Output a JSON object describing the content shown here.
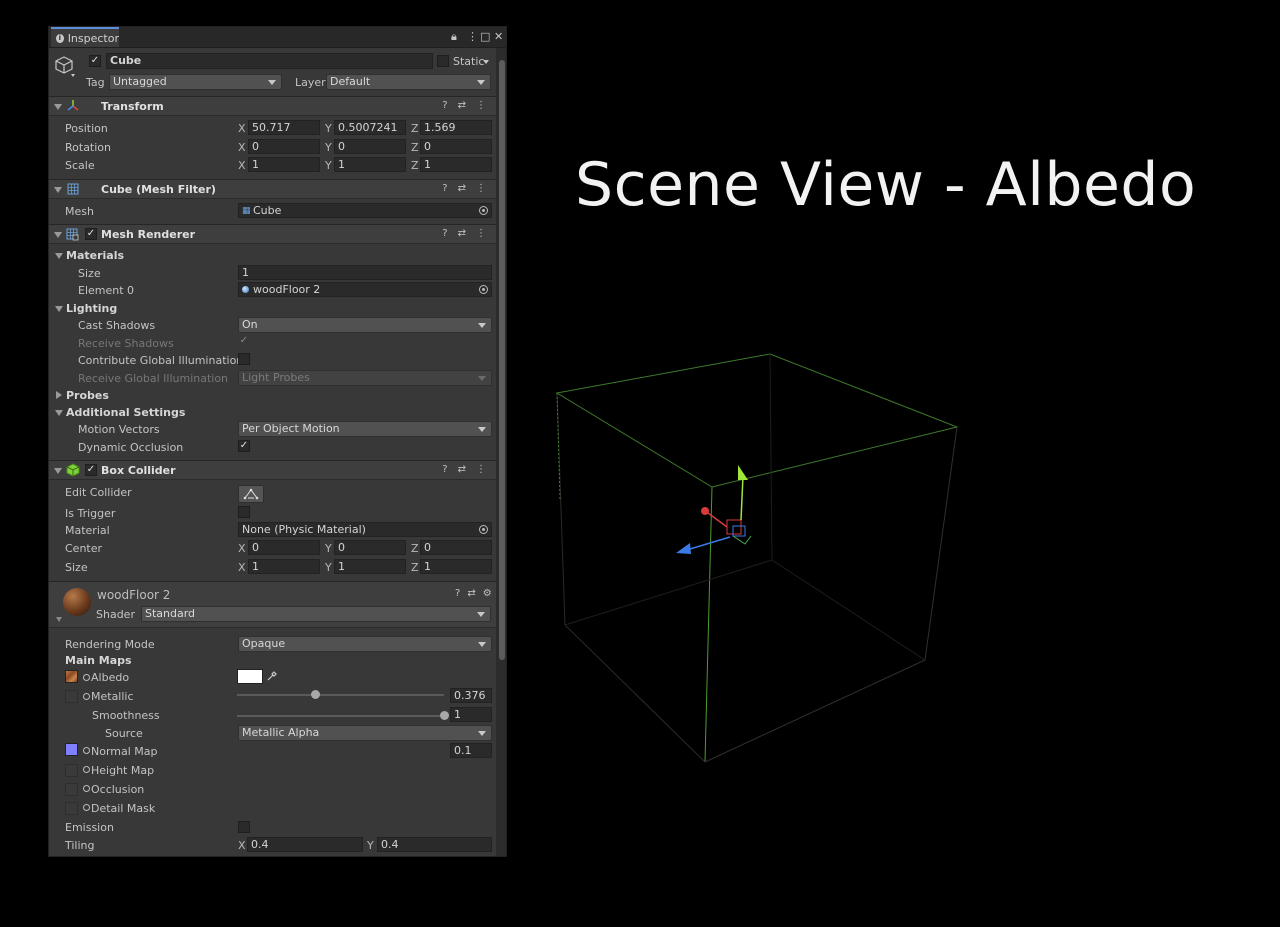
{
  "window": {
    "tab": "Inspector"
  },
  "object": {
    "name": "Cube",
    "static_label": "Static",
    "tag_label": "Tag",
    "tag_value": "Untagged",
    "layer_label": "Layer",
    "layer_value": "Default"
  },
  "transform": {
    "title": "Transform",
    "position_label": "Position",
    "position": {
      "x": "50.717",
      "y": "0.5007241",
      "z": "1.569"
    },
    "rotation_label": "Rotation",
    "rotation": {
      "x": "0",
      "y": "0",
      "z": "0"
    },
    "scale_label": "Scale",
    "scale": {
      "x": "1",
      "y": "1",
      "z": "1"
    }
  },
  "axes": {
    "x": "X",
    "y": "Y",
    "z": "Z"
  },
  "mesh_filter": {
    "title": "Cube (Mesh Filter)",
    "mesh_label": "Mesh",
    "mesh_value": "Cube"
  },
  "mesh_renderer": {
    "title": "Mesh Renderer",
    "materials_label": "Materials",
    "size_label": "Size",
    "size_value": "1",
    "element0_label": "Element 0",
    "element0_value": "woodFloor 2",
    "lighting_label": "Lighting",
    "cast_shadows_label": "Cast Shadows",
    "cast_shadows_value": "On",
    "receive_shadows_label": "Receive Shadows",
    "contribute_gi_label": "Contribute Global Illumination",
    "receive_gi_label": "Receive Global Illumination",
    "receive_gi_value": "Light Probes",
    "probes_label": "Probes",
    "additional_label": "Additional Settings",
    "motion_vectors_label": "Motion Vectors",
    "motion_vectors_value": "Per Object Motion",
    "dynamic_occlusion_label": "Dynamic Occlusion"
  },
  "box_collider": {
    "title": "Box Collider",
    "edit_label": "Edit Collider",
    "trigger_label": "Is Trigger",
    "material_label": "Material",
    "material_value": "None (Physic Material)",
    "center_label": "Center",
    "center": {
      "x": "0",
      "y": "0",
      "z": "0"
    },
    "size_label": "Size",
    "size": {
      "x": "1",
      "y": "1",
      "z": "1"
    }
  },
  "material": {
    "name": "woodFloor 2",
    "shader_label": "Shader",
    "shader_value": "Standard",
    "rendering_mode_label": "Rendering Mode",
    "rendering_mode_value": "Opaque",
    "main_maps_label": "Main Maps",
    "albedo_label": "Albedo",
    "metallic_label": "Metallic",
    "metallic_value": "0.376",
    "metallic_fraction": 0.376,
    "smoothness_label": "Smoothness",
    "smoothness_value": "1",
    "smoothness_fraction": 1.0,
    "source_label": "Source",
    "source_value": "Metallic Alpha",
    "normal_label": "Normal Map",
    "normal_value": "0.1",
    "height_label": "Height Map",
    "occlusion_label": "Occlusion",
    "detail_label": "Detail Mask",
    "emission_label": "Emission",
    "tiling_label": "Tiling",
    "tiling": {
      "x": "0.4",
      "y": "0.4"
    }
  },
  "scene": {
    "title": "Scene View - Albedo"
  },
  "colors": {
    "panel": "#383838",
    "header": "#3e3e3e",
    "field": "#2a2a2a",
    "tab_accent": "#5b8ed6",
    "cube_edge": "#3f7a2a",
    "gizmo_x": "#d93a3a",
    "gizmo_y": "#9ee63a",
    "gizmo_z": "#3a7ae6"
  }
}
